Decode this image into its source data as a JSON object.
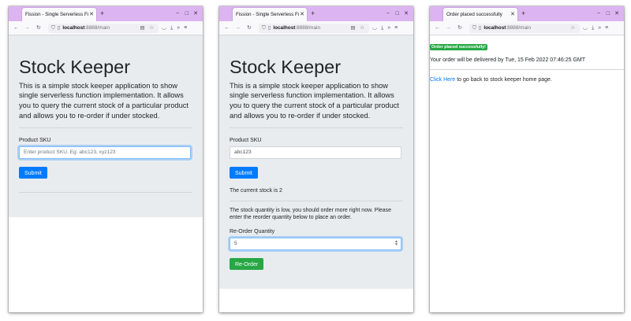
{
  "windows": [
    {
      "tab_title": "Fission - Single Serverless Fu",
      "url_host": "localhost",
      "url_rest": ":8888/main",
      "page": {
        "heading": "Stock Keeper",
        "lead": "This is a simple stock keeper application to show single serverless function implementation. It allows you to query the current stock of a particular product and allows you to re-order if under stocked.",
        "sku_label": "Product SKU",
        "sku_placeholder": "Enter product SKU. Eg: abc123, xyz123",
        "submit_label": "Submit"
      }
    },
    {
      "tab_title": "Fission - Single Serverless Fu",
      "url_host": "localhost",
      "url_rest": ":8888/main",
      "page": {
        "heading": "Stock Keeper",
        "lead": "This is a simple stock keeper application to show single serverless function implementation. It allows you to query the current stock of a particular product and allows you to re-order if under stocked.",
        "sku_label": "Product SKU",
        "sku_value": "abc123",
        "submit_label": "Submit",
        "stock_text": "The current stock is 2",
        "low_stock_text": "The stock quantity is low, you should order more right now. Please enter the reorder quantity below to place an order.",
        "reorder_label": "Re-Order Quantity",
        "reorder_value": "5",
        "reorder_button": "Re-Order"
      }
    },
    {
      "tab_title": "Order placed successfully",
      "url_host": "localhost",
      "url_rest": ":8888/main",
      "page": {
        "badge": "Order placed successfully!",
        "delivery_text": "Your order will be delivered by Tue, 15 Feb 2022 07:46:25 GMT",
        "link_text": "Click Here",
        "link_suffix": " to go back to stock keeper home page."
      }
    }
  ],
  "icons": {
    "back": "arrow-left-icon",
    "forward": "arrow-right-icon",
    "reload": "reload-icon",
    "shield": "shield-icon",
    "page": "page-icon",
    "reader": "reader-view-icon",
    "bookmark": "star-icon",
    "pocket": "pocket-icon",
    "download": "download-icon",
    "overflow": "chevrons-right-icon",
    "menu": "hamburger-menu-icon"
  },
  "colors": {
    "tabbar": "#dcb4f1",
    "primary": "#007bff",
    "success": "#28a745",
    "jumbotron": "#e9ecef"
  }
}
